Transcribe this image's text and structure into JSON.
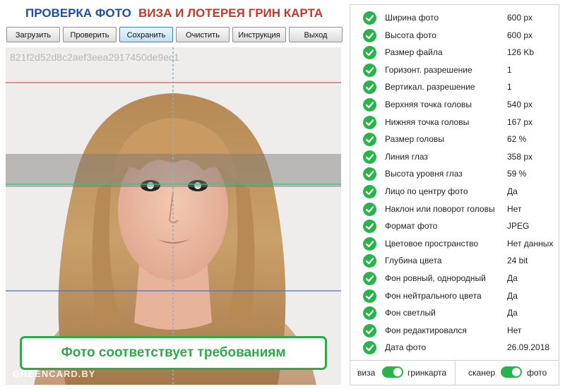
{
  "header": {
    "title_left": "ПРОВЕРКА ФОТО",
    "title_right": "ВИЗА И ЛОТЕРЕЯ ГРИН КАРТА"
  },
  "toolbar": {
    "buttons": [
      {
        "label": "Загрузить"
      },
      {
        "label": "Проверить"
      },
      {
        "label": "Сохранить"
      },
      {
        "label": "Очистить"
      },
      {
        "label": "Инструкция"
      },
      {
        "label": "Выход"
      }
    ]
  },
  "photo": {
    "hash": "821f2d52d8c2aef3eea2917450de9ec1",
    "watermark": "GREENCARD.BY",
    "status_message": "Фото соответствует требованиям",
    "line_colors": {
      "top": "#e05a5a",
      "eyes": "#2ecc71",
      "chin": "#4a6fd8",
      "center": "#7fb7c9"
    }
  },
  "checks": [
    {
      "label": "Ширина фото",
      "value": "600 px"
    },
    {
      "label": "Высота фото",
      "value": "600 px"
    },
    {
      "label": "Размер файла",
      "value": "126 Kb"
    },
    {
      "label": "Горизонт. разрешение",
      "value": "1"
    },
    {
      "label": "Вертикал. разрешение",
      "value": "1"
    },
    {
      "label": "Верхняя точка головы",
      "value": "540 px"
    },
    {
      "label": "Нижняя точка головы",
      "value": "167 px"
    },
    {
      "label": "Размер головы",
      "value": "62 %"
    },
    {
      "label": "Линия глаз",
      "value": "358 px"
    },
    {
      "label": "Высота уровня глаз",
      "value": "59 %"
    },
    {
      "label": "Лицо по центру фото",
      "value": "Да"
    },
    {
      "label": "Наклон или поворот головы",
      "value": "Нет"
    },
    {
      "label": "Формат фото",
      "value": "JPEG"
    },
    {
      "label": "Цветовое пространство",
      "value": "Нет данных"
    },
    {
      "label": "Глубина цвета",
      "value": "24 bit"
    },
    {
      "label": "Фон ровный, однородный",
      "value": "Да"
    },
    {
      "label": "Фон нейтрального цвета",
      "value": "Да"
    },
    {
      "label": "Фон светлый",
      "value": "Да"
    },
    {
      "label": "Фон редактировался",
      "value": "Нет"
    },
    {
      "label": "Дата фото",
      "value": "26.09.2018"
    }
  ],
  "toggles": {
    "left_off_label": "виза",
    "left_on_label": "гринкарта",
    "right_off_label": "сканер",
    "right_on_label": "фото"
  },
  "colors": {
    "accent_green": "#29b34a",
    "title_blue": "#1f4e9c",
    "title_red": "#c0392b"
  }
}
